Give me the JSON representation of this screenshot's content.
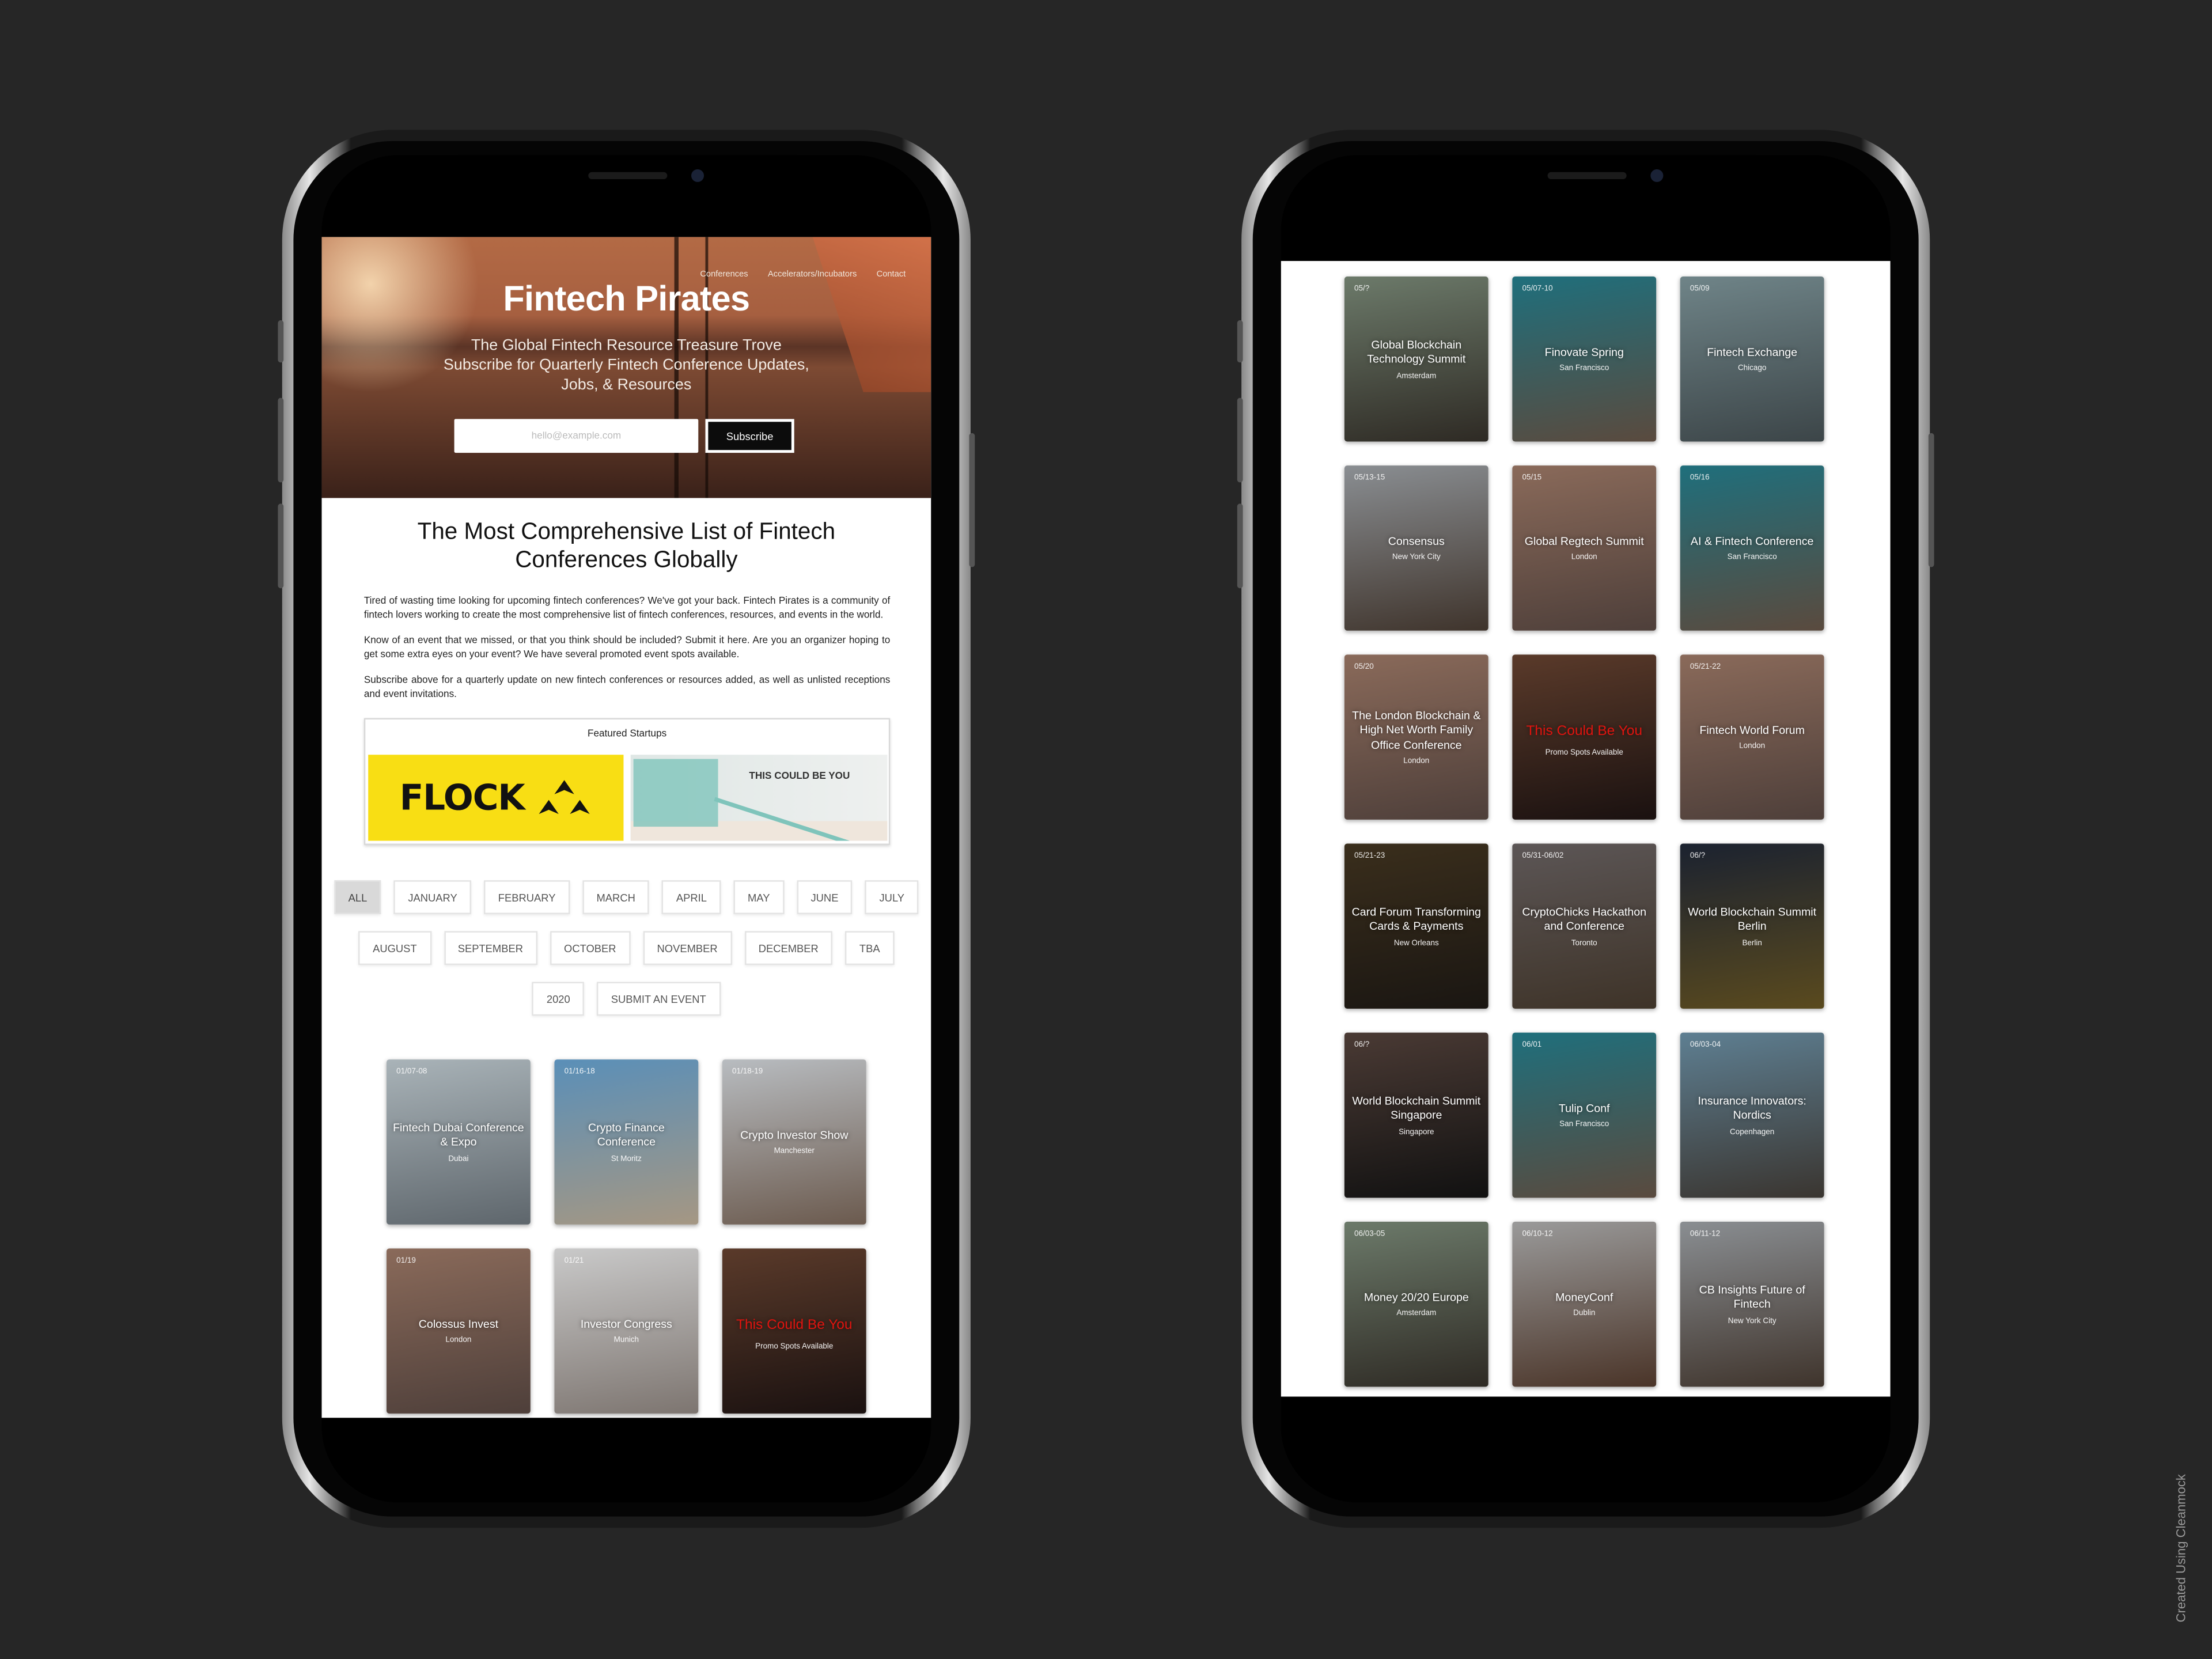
{
  "left_screen": {
    "nav": [
      "Conferences",
      "Accelerators/Incubators",
      "Contact"
    ],
    "hero": {
      "title": "Fintech Pirates",
      "subtitle_lines": [
        "The Global Fintech Resource Treasure Trove",
        "Subscribe for Quarterly Fintech Conference Updates,",
        "Jobs, & Resources"
      ],
      "email_placeholder": "hello@example.com",
      "subscribe_label": "Subscribe"
    },
    "heading_lines": [
      "The Most Comprehensive List of Fintech",
      "Conferences Globally"
    ],
    "paragraphs": [
      "Tired of wasting time looking for upcoming fintech conferences? We've got your back. Fintech Pirates is a community of fintech lovers working to create the most comprehensive list of fintech conferences, resources, and events in the world.",
      "Know of an event that we missed, or that you think should be included? Submit it here. Are you an organizer hoping to get some extra eyes on your event? We have several promoted event spots available.",
      "Subscribe above for a quarterly update on new fintech conferences or resources added, as well as unlisted receptions and event invitations."
    ],
    "featured": {
      "label": "Featured Startups",
      "flock_logo": "FLOCK",
      "flock_color": "#f8de14",
      "promo_text": "THIS COULD BE YOU"
    },
    "filters": {
      "active": "ALL",
      "rows": [
        [
          "ALL",
          "JANUARY",
          "FEBRUARY",
          "MARCH",
          "APRIL",
          "MAY",
          "JUNE",
          "JULY"
        ],
        [
          "AUGUST",
          "SEPTEMBER",
          "OCTOBER",
          "NOVEMBER",
          "DECEMBER",
          "TBA"
        ],
        [
          "2020",
          "SUBMIT AN EVENT"
        ]
      ]
    },
    "cards": [
      {
        "date": "01/07-08",
        "title": "Fintech Dubai Conference & Expo",
        "city": "Dubai",
        "colors": [
          "#a9b3b8",
          "#5e666c"
        ]
      },
      {
        "date": "01/16-18",
        "title": "Crypto Finance Conference",
        "city": "St Moritz",
        "colors": [
          "#5a8fb8",
          "#a59783"
        ]
      },
      {
        "date": "01/18-19",
        "title": "Crypto Investor Show",
        "city": "Manchester",
        "colors": [
          "#b8bcc0",
          "#6b5a4e"
        ]
      },
      {
        "date": "01/19",
        "title": "Colossus Invest",
        "city": "London",
        "colors": [
          "#8a6a5a",
          "#4e3f3a"
        ]
      },
      {
        "date": "01/21",
        "title": "Investor Congress",
        "city": "Munich",
        "colors": [
          "#c9c9c9",
          "#7d7570"
        ]
      },
      {
        "date": "",
        "title": "This Could Be You",
        "city": "Promo Spots Available",
        "promo": true,
        "colors": [
          "#5a3a2a",
          "#1a1110"
        ]
      }
    ]
  },
  "right_screen": {
    "cards": [
      {
        "date": "05/?",
        "title": "Global Blockchain Technology Summit",
        "city": "Amsterdam",
        "colors": [
          "#6c7a6a",
          "#2e2a24"
        ]
      },
      {
        "date": "05/07-10",
        "title": "Finovate Spring",
        "city": "San Francisco",
        "colors": [
          "#1f6f7c",
          "#5a4a3e"
        ]
      },
      {
        "date": "05/09",
        "title": "Fintech Exchange",
        "city": "Chicago",
        "colors": [
          "#6f8488",
          "#3c4548"
        ]
      },
      {
        "date": "05/13-15",
        "title": "Consensus",
        "city": "New York City",
        "colors": [
          "#8a8e92",
          "#3f342c"
        ]
      },
      {
        "date": "05/15",
        "title": "Global Regtech Summit",
        "city": "London",
        "colors": [
          "#8a6a5a",
          "#4e3f3a"
        ]
      },
      {
        "date": "05/16",
        "title": "AI & Fintech Conference",
        "city": "San Francisco",
        "colors": [
          "#1f6f7c",
          "#5a4a3e"
        ]
      },
      {
        "date": "05/20",
        "title": "The London Blockchain & High Net Worth Family Office Conference",
        "city": "London",
        "colors": [
          "#8a6a5a",
          "#4e3f3a"
        ]
      },
      {
        "date": "",
        "title": "This Could Be You",
        "city": "Promo Spots Available",
        "promo": true,
        "colors": [
          "#5a3a2a",
          "#1a1110"
        ]
      },
      {
        "date": "05/21-22",
        "title": "Fintech World Forum",
        "city": "London",
        "colors": [
          "#8a6a5a",
          "#4e3f3a"
        ]
      },
      {
        "date": "05/21-23",
        "title": "Card Forum Transforming Cards & Payments",
        "city": "New Orleans",
        "colors": [
          "#3a2e1c",
          "#1a1612"
        ]
      },
      {
        "date": "05/31-06/02",
        "title": "CryptoChicks Hackathon and Conference",
        "city": "Toronto",
        "colors": [
          "#5c5656",
          "#3e3328"
        ]
      },
      {
        "date": "06/?",
        "title": "World Blockchain Summit Berlin",
        "city": "Berlin",
        "colors": [
          "#1b2230",
          "#5a4a1e"
        ]
      },
      {
        "date": "06/?",
        "title": "World Blockchain Summit Singapore",
        "city": "Singapore",
        "colors": [
          "#4a3a34",
          "#111"
        ]
      },
      {
        "date": "06/01",
        "title": "Tulip Conf",
        "city": "San Francisco",
        "colors": [
          "#1f6f7c",
          "#5a4a3e"
        ]
      },
      {
        "date": "06/03-04",
        "title": "Insurance Innovators: Nordics",
        "city": "Copenhagen",
        "colors": [
          "#5e7f92",
          "#3a3530"
        ]
      },
      {
        "date": "06/03-05",
        "title": "Money 20/20 Europe",
        "city": "Amsterdam",
        "colors": [
          "#6c7a6a",
          "#2e2a24"
        ]
      },
      {
        "date": "06/10-12",
        "title": "MoneyConf",
        "city": "Dublin",
        "colors": [
          "#9a9a9a",
          "#4a3428"
        ]
      },
      {
        "date": "06/11-12",
        "title": "CB Insights Future of Fintech",
        "city": "New York City",
        "colors": [
          "#8a8e92",
          "#3f342c"
        ]
      }
    ]
  },
  "watermark": "Created Using Cleanmock"
}
